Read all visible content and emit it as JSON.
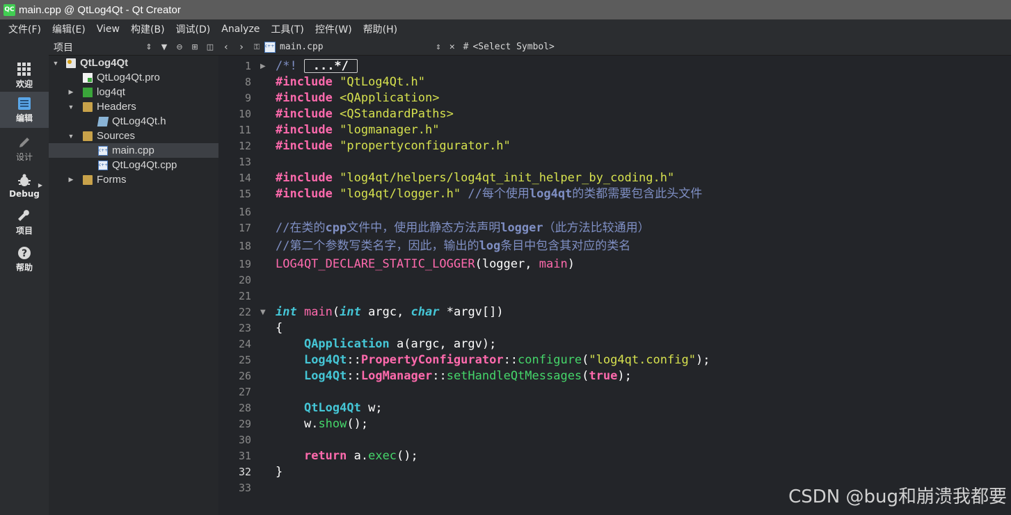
{
  "window": {
    "title": "main.cpp @ QtLog4Qt - Qt Creator",
    "logo": "QC"
  },
  "menu": [
    "文件(F)",
    "编辑(E)",
    "View",
    "构建(B)",
    "调试(D)",
    "Analyze",
    "工具(T)",
    "控件(W)",
    "帮助(H)"
  ],
  "modes": [
    {
      "label": "欢迎",
      "icon": "grid-icon"
    },
    {
      "label": "编辑",
      "icon": "document-icon",
      "active": true
    },
    {
      "label": "设计",
      "icon": "pencil-icon"
    },
    {
      "label": "Debug",
      "icon": "bug-icon"
    },
    {
      "label": "项目",
      "icon": "wrench-icon"
    },
    {
      "label": "帮助",
      "icon": "help-icon"
    }
  ],
  "project_pane": {
    "combo": "项目",
    "tree": [
      {
        "label": "QtLog4Qt",
        "expanded": true,
        "bold": true
      },
      {
        "label": "QtLog4Qt.pro"
      },
      {
        "label": "log4qt",
        "expanded": false
      },
      {
        "label": "Headers",
        "expanded": true
      },
      {
        "label": "QtLog4Qt.h"
      },
      {
        "label": "Sources",
        "expanded": true
      },
      {
        "label": "main.cpp",
        "selected": true
      },
      {
        "label": "QtLog4Qt.cpp"
      },
      {
        "label": "Forms",
        "expanded": false
      }
    ]
  },
  "editor": {
    "file": "main.cpp",
    "symbol_hash": "#",
    "symbol": "<Select Symbol>",
    "current_line": "32",
    "line_numbers": [
      "1",
      "8",
      "9",
      "10",
      "11",
      "12",
      "13",
      "14",
      "15",
      "16",
      "17",
      "18",
      "19",
      "20",
      "21",
      "22",
      "23",
      "24",
      "25",
      "26",
      "27",
      "28",
      "29",
      "30",
      "31",
      "32",
      "33"
    ],
    "code": {
      "l1_comment": "/*!",
      "l1_collapsed": "...*/",
      "include": "#include",
      "l8_arg": "\"QtLog4Qt.h\"",
      "l9_arg": "<QApplication>",
      "l10_arg": "<QStandardPaths>",
      "l11_arg": "\"logmanager.h\"",
      "l12_arg": "\"propertyconfigurator.h\"",
      "l14_arg": "\"log4qt/helpers/log4qt_init_helper_by_coding.h\"",
      "l15_arg": "\"log4qt/logger.h\"",
      "l15_comment_a": "//每个使用",
      "l15_comment_b": "log4qt",
      "l15_comment_c": "的类都需要包含此头文件",
      "l17_a": "//在类的",
      "l17_b": "cpp",
      "l17_c": "文件中，使用此静态方法声明",
      "l17_d": "logger",
      "l17_e": "（此方法比较通用）",
      "l18_a": "//第二个参数写类名字，因此，输出的",
      "l18_b": "log",
      "l18_c": "条目中包含其对应的类名",
      "l19_macro": "LOG4QT_DECLARE_STATIC_LOGGER",
      "l19_a": "(",
      "l19_b": "logger",
      "l19_c": ", ",
      "l19_d": "main",
      "l19_e": ")",
      "l22_int": "int",
      "l22_main": "main",
      "l22_p1": "(",
      "l22_int2": "int",
      "l22_argc": " argc, ",
      "l22_char": "char",
      "l22_rest": " *argv[])",
      "l23": "{",
      "l24_type": "QApplication",
      "l24_rest": " a(argc, argv);",
      "l25_ns": "Log4Qt",
      "l25_sep1": "::",
      "l25_cls": "PropertyConfigurator",
      "l25_sep2": "::",
      "l25_fn": "configure",
      "l25_p1": "(",
      "l25_str": "\"log4qt.config\"",
      "l25_p2": ");",
      "l26_ns": "Log4Qt",
      "l26_sep1": "::",
      "l26_cls": "LogManager",
      "l26_sep2": "::",
      "l26_fn": "setHandleQtMessages",
      "l26_p1": "(",
      "l26_true": "true",
      "l26_p2": ");",
      "l28_type": "QtLog4Qt",
      "l28_rest": " w;",
      "l29_a": "w.",
      "l29_fn": "show",
      "l29_b": "();",
      "l31_kw": "return",
      "l31_a": " a.",
      "l31_fn": "exec",
      "l31_b": "();",
      "l32": "}"
    }
  },
  "watermark": "CSDN @bug和崩溃我都要"
}
